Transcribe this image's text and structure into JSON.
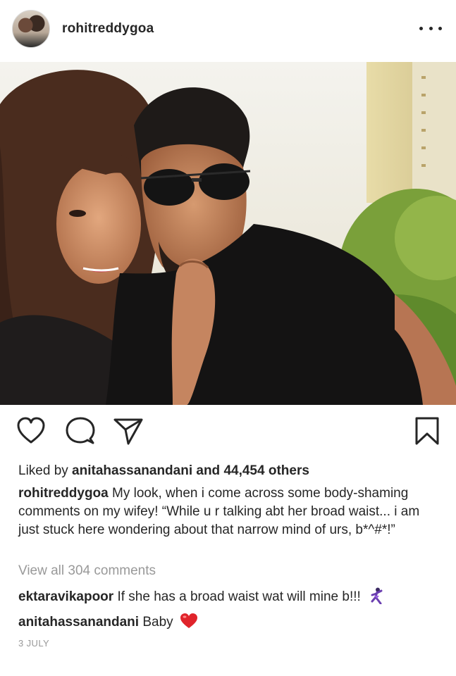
{
  "post": {
    "username": "rohitreddygoa",
    "more_icon": "more-horizontal-icon",
    "likes": {
      "prefix": "Liked by ",
      "user": "anitahassanandani",
      "suffix": " and 44,454 others"
    },
    "caption": {
      "user": "rohitreddygoa",
      "text": " My look, when i come across some body-shaming comments on my wifey! “While u r talking abt her broad waist... i am just stuck here wondering about that narrow mind of urs, b*^#*!”"
    },
    "view_all_comments": "View all 304 comments",
    "comments": [
      {
        "user": "ektaravikapoor",
        "text": " If she has a broad waist wat will mine b!!! "
      },
      {
        "user": "anitahassanandani",
        "text": " Baby "
      }
    ],
    "date": "3 JULY",
    "icons": {
      "like": "heart-outline-icon",
      "comment": "comment-bubble-icon",
      "share": "paper-plane-icon",
      "save": "bookmark-icon"
    },
    "colors": {
      "heart": "#e0242b",
      "secondary_text": "#999999"
    }
  }
}
